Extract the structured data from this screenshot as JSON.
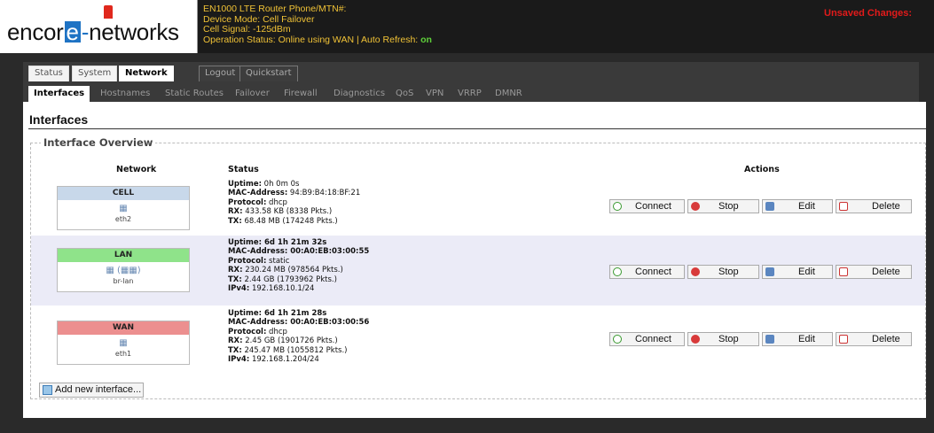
{
  "header": {
    "logo": {
      "prefix": "encor",
      "e": "e",
      "dot": "-",
      "suffix": "networks"
    },
    "info_lines": [
      "EN1000 LTE Router Phone/MTN#:",
      "Device Mode: Cell Failover",
      "Cell Signal: -125dBm",
      "Operation Status: Online using WAN | Auto Refresh:"
    ],
    "auto_refresh": "on",
    "unsaved_label": "Unsaved Changes:"
  },
  "menu": {
    "tabs": [
      "Status",
      "System",
      "Network",
      "Logout",
      "Quickstart"
    ],
    "active": "Network"
  },
  "submenu": {
    "tabs": [
      "Interfaces",
      "Hostnames",
      "Static Routes",
      "Failover",
      "Firewall",
      "Diagnostics",
      "QoS",
      "VPN",
      "VRRP",
      "DMNR"
    ],
    "active": "Interfaces"
  },
  "page": {
    "title": "Interfaces",
    "legend": "Interface Overview",
    "columns": {
      "network": "Network",
      "status": "Status",
      "actions": "Actions"
    }
  },
  "interfaces": [
    {
      "name": "CELL",
      "color": "#c8d8ea",
      "device": "eth2",
      "icon": "network-port-icon",
      "status": [
        {
          "k": "Uptime:",
          "v": " 0h 0m 0s"
        },
        {
          "k": "MAC-Address:",
          "v": " 94:B9:B4:18:BF:21"
        },
        {
          "k": "Protocol:",
          "v": " dhcp"
        },
        {
          "k": "RX:",
          "v": " 433.58 KB (8338 Pkts.)"
        },
        {
          "k": "TX:",
          "v": " 68.48 MB (174248 Pkts.)"
        }
      ]
    },
    {
      "name": "LAN",
      "color": "#8fe38a",
      "device": "br-lan",
      "icon": "bridge-icon",
      "status": [
        {
          "k": "Uptime:",
          "v": " 6d 1h 21m 32s"
        },
        {
          "k": "MAC-Address:",
          "v": " 00:A0:EB:03:00:55"
        },
        {
          "k": "Protocol:",
          "v": " static"
        },
        {
          "k": "RX:",
          "v": " 230.24 MB (978564 Pkts.)"
        },
        {
          "k": "TX:",
          "v": " 2.44 GB (1793962 Pkts.)"
        },
        {
          "k": "IPv4:",
          "v": " 192.168.10.1/24"
        }
      ]
    },
    {
      "name": "WAN",
      "color": "#ec8f8f",
      "device": "eth1",
      "icon": "network-port-icon",
      "status": [
        {
          "k": "Uptime:",
          "v": " 6d 1h 21m 28s"
        },
        {
          "k": "MAC-Address:",
          "v": " 00:A0:EB:03:00:56"
        },
        {
          "k": "Protocol:",
          "v": " dhcp"
        },
        {
          "k": "RX:",
          "v": " 2.45 GB (1901726 Pkts.)"
        },
        {
          "k": "TX:",
          "v": " 245.47 MB (1055812 Pkts.)"
        },
        {
          "k": "IPv4:",
          "v": " 192.168.1.204/24"
        }
      ]
    }
  ],
  "actions": {
    "connect": "Connect",
    "stop": "Stop",
    "edit": "Edit",
    "delete": "Delete"
  },
  "add_interface": "Add new interface..."
}
